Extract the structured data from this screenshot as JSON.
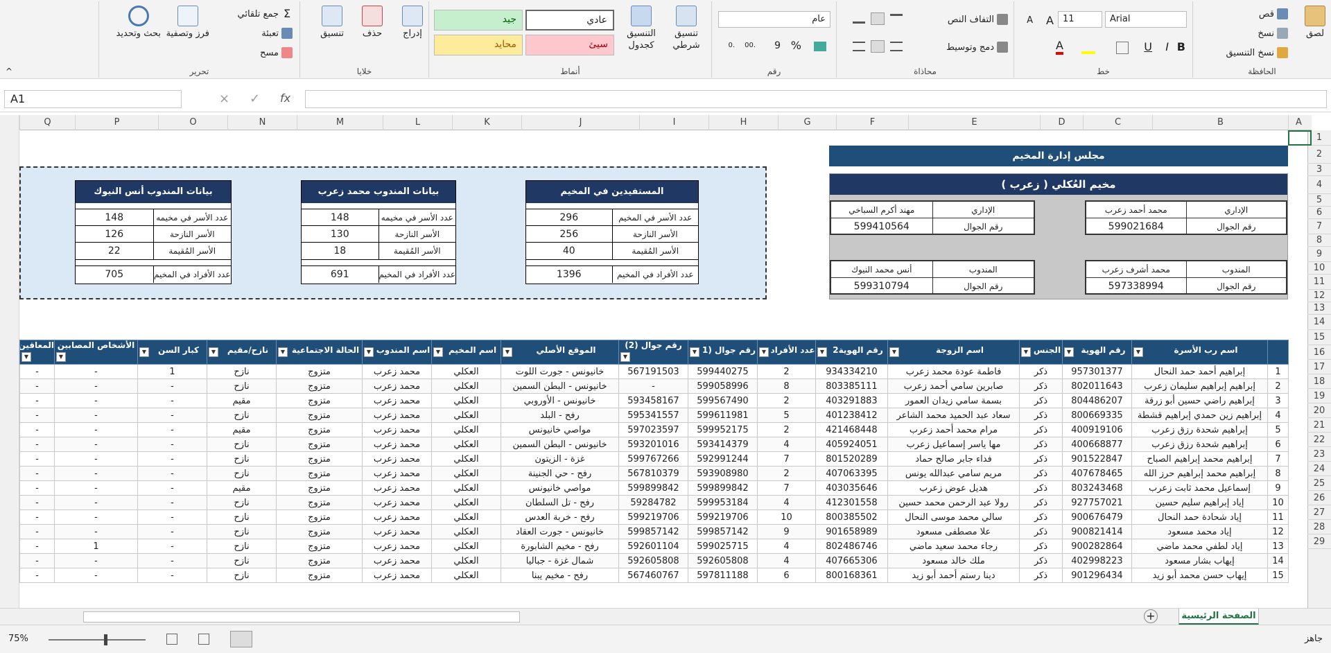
{
  "ribbon": {
    "clipboard": {
      "title": "الحافظة",
      "paste": "لصق",
      "cut": "قص",
      "copy": "نسخ",
      "format_painter": "نسخ التنسيق"
    },
    "font": {
      "title": "خط",
      "font_name": "Arial",
      "font_size": "11",
      "bold": "B",
      "italic": "I",
      "underline": "U"
    },
    "alignment": {
      "title": "محاذاة",
      "wrap": "التفاف النص",
      "merge": "دمج وتوسيط"
    },
    "number": {
      "title": "رقم",
      "format": "عام",
      "percent": "%",
      "comma": "9"
    },
    "styles": {
      "title": "أنماط",
      "cond_format": "تنسيق شرطي",
      "table_format": "التنسيق كجدول",
      "normal": "عادي",
      "good": "جيد",
      "bad": "سيئ",
      "neutral": "محايد"
    },
    "cells": {
      "title": "خلايا",
      "insert": "إدراج",
      "delete": "حذف",
      "format": "تنسيق"
    },
    "editing": {
      "title": "تحرير",
      "autosum": "جمع تلقائي",
      "fill": "تعبئة",
      "clear": "مسح",
      "sort": "فرز وتصفية",
      "find": "بحث وتحديد"
    }
  },
  "formula_bar": {
    "name_box": "A1",
    "fx": "fx"
  },
  "columns": [
    "Q",
    "P",
    "O",
    "N",
    "M",
    "L",
    "K",
    "J",
    "I",
    "H",
    "G",
    "F",
    "E",
    "D",
    "C",
    "B",
    "A"
  ],
  "rows": [
    "1",
    "2",
    "3",
    "4",
    "5",
    "6",
    "7",
    "8",
    "9",
    "10",
    "11",
    "12",
    "13",
    "14",
    "15",
    "16",
    "17",
    "18",
    "19",
    "20",
    "21",
    "22",
    "23",
    "24",
    "25",
    "26",
    "27",
    "28",
    "29"
  ],
  "dashboard": {
    "council_title": "مجلس إدارة المخيم",
    "camp_title": "مخيم العُكلي ( زعرب )",
    "contacts": [
      {
        "role": "الإداري",
        "name": "محمد أحمد زعرب",
        "phone_label": "رقم الجوال",
        "phone": "599021684"
      },
      {
        "role": "الإداري",
        "name": "مهند أكرم السباخي",
        "phone_label": "رقم الجوال",
        "phone": "599410564"
      },
      {
        "role": "المندوب",
        "name": "محمد أشرف زعرب",
        "phone_label": "رقم الجوال",
        "phone": "597338994"
      },
      {
        "role": "المندوب",
        "name": "أنس محمد النيوك",
        "phone_label": "رقم الجوال",
        "phone": "599310794"
      }
    ],
    "cards": [
      {
        "title": "المستفيدين في المخيم",
        "r1l": "عدد الأسر في المخيم",
        "r1v": "296",
        "r2l": "الأسر النازحة",
        "r2v": "256",
        "r3l": "الأسر المُقيمة",
        "r3v": "40",
        "r4l": "عدد الأفراد في المخيم",
        "r4v": "1396"
      },
      {
        "title": "بيانات المندوب محمد زعرب",
        "r1l": "عدد الأسر في مخيمه",
        "r1v": "148",
        "r2l": "الأسر النازحة",
        "r2v": "130",
        "r3l": "الأسر المُقيمة",
        "r3v": "18",
        "r4l": "عدد الأفراد في المخيم",
        "r4v": "691"
      },
      {
        "title": "بيانات المندوب أنس النيوك",
        "r1l": "عدد الأسر في مخيمه",
        "r1v": "148",
        "r2l": "الأسر النازحة",
        "r2v": "126",
        "r3l": "الأسر المُقيمة",
        "r3v": "22",
        "r4l": "عدد الأفراد في المخيم",
        "r4v": "705"
      }
    ]
  },
  "table": {
    "headers": [
      "",
      "اسم رب الأسرة",
      "رقم الهوية",
      "الجنس",
      "اسم الزوجة",
      "رقم الهوية2",
      "عدد الأفراد",
      "رقم جوال (1",
      "رقم جوال (2)",
      "الموقع الأصلي",
      "اسم المخيم",
      "اسم المندوب",
      "الحالة الاجتماعية",
      "نازح/مقيم",
      "كبار السن",
      "الأشخاص المصابين",
      "المعاقين"
    ],
    "rows": [
      [
        "1",
        "إبراهيم أحمد حمد النحال",
        "957301377",
        "ذكر",
        "فاطمة عودة محمد زعرب",
        "934334210",
        "2",
        "599440275",
        "567191503",
        "خانيونس - جورت اللوت",
        "العكلي",
        "محمد زعرب",
        "متزوج",
        "نازح",
        "1",
        "-",
        "-"
      ],
      [
        "2",
        "إبراهيم إبراهيم سليمان زعرب",
        "802011643",
        "ذكر",
        "صابرين سامي أحمد زعرب",
        "803385111",
        "8",
        "599058996",
        "-",
        "خانيونس - البطن السمين",
        "العكلي",
        "محمد زعرب",
        "متزوج",
        "نازح",
        "-",
        "-",
        "-"
      ],
      [
        "3",
        "إبراهيم راضي حسين أبو زرقة",
        "804486207",
        "ذكر",
        "بسمة سامي زيدان العمور",
        "403291883",
        "2",
        "599567490",
        "593458167",
        "خانيونس - الأوروبي",
        "العكلي",
        "محمد زعرب",
        "متزوج",
        "مقيم",
        "-",
        "-",
        "-"
      ],
      [
        "4",
        "إبراهيم زين حمدي إبراهيم قشطة",
        "800669335",
        "ذكر",
        "سعاد عبد الحميد محمد الشاعر",
        "401238412",
        "5",
        "599611981",
        "595341557",
        "رفح - البلد",
        "العكلي",
        "محمد زعرب",
        "متزوج",
        "نازح",
        "-",
        "-",
        "-"
      ],
      [
        "5",
        "إبراهيم شحدة رزق زعرب",
        "400919106",
        "ذكر",
        "مرام محمد أحمد زعرب",
        "421468448",
        "2",
        "599952175",
        "597023597",
        "مواصي خانيونس",
        "العكلي",
        "محمد زعرب",
        "متزوج",
        "مقيم",
        "-",
        "-",
        "-"
      ],
      [
        "6",
        "إبراهيم شحدة رزق زعرب",
        "400668877",
        "ذكر",
        "مها ياسر إسماعيل زعرب",
        "405924051",
        "4",
        "593414379",
        "593201016",
        "خانيونس - البطن السمين",
        "العكلي",
        "محمد زعرب",
        "متزوج",
        "نازح",
        "-",
        "-",
        "-"
      ],
      [
        "7",
        "إبراهيم محمد إبراهيم الصباح",
        "901522847",
        "ذكر",
        "فداء جابر صالح حماد",
        "801520289",
        "7",
        "592991244",
        "599767266",
        "غزة - الزيتون",
        "العكلي",
        "محمد زعرب",
        "متزوج",
        "نازح",
        "-",
        "-",
        "-"
      ],
      [
        "8",
        "إبراهيم محمد إبراهيم حرز الله",
        "407678465",
        "ذكر",
        "مريم سامي عبدالله يونس",
        "407063395",
        "2",
        "593908980",
        "567810379",
        "رفح - حي الجنينة",
        "العكلي",
        "محمد زعرب",
        "متزوج",
        "نازح",
        "-",
        "-",
        "-"
      ],
      [
        "9",
        "إسماعيل محمد ثابت زعرب",
        "803243468",
        "ذكر",
        "هديل عوض زعرب",
        "403035646",
        "7",
        "599899842",
        "599899842",
        "مواصي خانيونس",
        "العكلي",
        "محمد زعرب",
        "متزوج",
        "مقيم",
        "-",
        "-",
        "-"
      ],
      [
        "10",
        "إياد إبراهيم سليم حسين",
        "927757021",
        "ذكر",
        "رولا عبد الرحمن محمد حسين",
        "412301558",
        "4",
        "599953184",
        "59284782",
        "رفح - تل السلطان",
        "العكلي",
        "محمد زعرب",
        "متزوج",
        "نازح",
        "-",
        "-",
        "-"
      ],
      [
        "11",
        "إياد شحادة حمد النحال",
        "900676479",
        "ذكر",
        "سالي محمد موسى النحال",
        "800385502",
        "10",
        "599219706",
        "599219706",
        "رفح - خربة العدس",
        "العكلي",
        "محمد زعرب",
        "متزوج",
        "نازح",
        "-",
        "-",
        "-"
      ],
      [
        "12",
        "إياد محمد مسعود",
        "900821414",
        "ذكر",
        "علا مصطفى مسعود",
        "901658989",
        "9",
        "599857142",
        "599857142",
        "خانيونس - جورت العقاد",
        "العكلي",
        "محمد زعرب",
        "متزوج",
        "نازح",
        "-",
        "-",
        "-"
      ],
      [
        "13",
        "إياد لطفي محمد ماضي",
        "900282864",
        "ذكر",
        "رجاء محمد سعيد ماضي",
        "802486746",
        "4",
        "599025715",
        "592601104",
        "رفح - مخيم الشابورة",
        "العكلي",
        "محمد زعرب",
        "متزوج",
        "نازح",
        "-",
        "1",
        "-"
      ],
      [
        "14",
        "إيهاب بشار مسعود",
        "402998223",
        "ذكر",
        "ملك خالد مسعود",
        "407665306",
        "4",
        "592605808",
        "592605808",
        "شمال غزة - جباليا",
        "العكلي",
        "محمد زعرب",
        "متزوج",
        "نازح",
        "-",
        "-",
        "-"
      ],
      [
        "15",
        "إيهاب حسن محمد أبو زيد",
        "901296434",
        "ذكر",
        "دينا رستم أحمد أبو زيد",
        "800168361",
        "6",
        "597811188",
        "567460767",
        "رفح - مخيم يبنا",
        "العكلي",
        "محمد زعرب",
        "متزوج",
        "نازح",
        "-",
        "-",
        "-"
      ]
    ]
  },
  "sheet_tab": "الصفحة الرئيسية",
  "status": {
    "ready": "جاهز",
    "zoom": "75%"
  },
  "colors": {
    "header_blue": "#1f4e79",
    "dark_blue": "#203864",
    "panel": "#dbe9f7",
    "gray": "#c8c8c8"
  }
}
